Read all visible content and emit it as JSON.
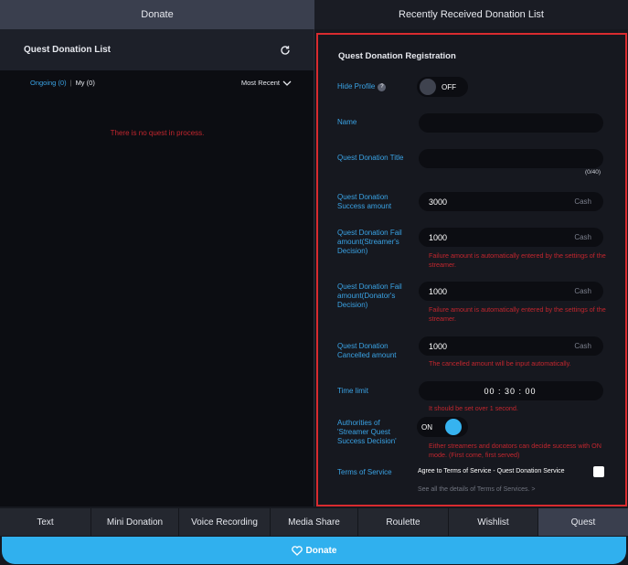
{
  "top_tabs": {
    "donate": "Donate",
    "recent": "Recently Received Donation List"
  },
  "left": {
    "title": "Quest Donation List",
    "filter_ongoing": "Ongoing (0)",
    "filter_sep": "|",
    "filter_my": "My (0)",
    "sort": "Most Recent",
    "empty": "There is no quest in process."
  },
  "form": {
    "title": "Quest Donation Registration",
    "hide_profile_label": "Hide Profile",
    "hide_profile_value": "OFF",
    "name_label": "Name",
    "name_value": "",
    "quest_title_label": "Quest Donation Title",
    "quest_title_value": "",
    "title_counter": "(0/40)",
    "success_label": "Quest Donation Success amount",
    "success_value": "3000",
    "fail_streamer_label": "Quest Donation Fail amount(Streamer's Decision)",
    "fail_streamer_value": "1000",
    "fail_note": "Failure amount is automatically entered by the settings of the streamer.",
    "fail_donator_label": "Quest Donation Fail amount(Donator's Decision)",
    "fail_donator_value": "1000",
    "cancel_label": "Quest Donation Cancelled amount",
    "cancel_value": "1000",
    "cancel_note": "The cancelled amount will be input automatically.",
    "cash_unit": "Cash",
    "time_label": "Time limit",
    "time_value": "00 : 30 : 00",
    "time_note": "It should be set over 1 second.",
    "authorities_label": "Authorities of 'Streamer Quest Success Decision'",
    "authorities_value": "ON",
    "authorities_note": "Either streamers and donators can decide success with ON mode. (First come, first served)",
    "terms_label": "Terms of Service",
    "terms_agree": "Agree to Terms of Service - Quest Donation Service",
    "terms_link": "See all the details of Terms of Services. >"
  },
  "bottom_tabs": [
    "Text",
    "Mini Donation",
    "Voice Recording",
    "Media Share",
    "Roulette",
    "Wishlist",
    "Quest"
  ],
  "donate_button": "Donate",
  "colors": {
    "accent": "#3aa3e5",
    "warning": "#c3262e",
    "highlight_border": "#d92b2f",
    "donate": "#30b0ee"
  },
  "icons": [
    "refresh-icon",
    "chevron-down-icon",
    "help-icon",
    "heart-icon"
  ]
}
